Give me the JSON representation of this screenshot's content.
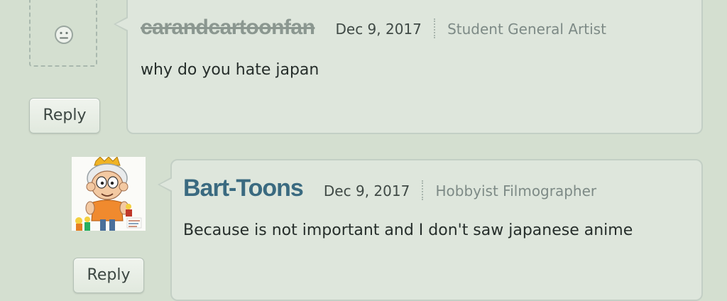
{
  "comments": [
    {
      "username": "carandcartoonfan",
      "username_deleted": true,
      "date": "Dec 9, 2017",
      "user_title": "Student General Artist",
      "text": "why do you hate japan",
      "reply_label": "Reply",
      "avatar_icon": "neutral-face-icon"
    },
    {
      "username": "Bart-Toons",
      "username_deleted": false,
      "date": "Dec 9, 2017",
      "user_title": "Hobbyist Filmographer",
      "text": "Because is not important and I don't saw japanese anime",
      "reply_label": "Reply",
      "avatar_icon": "cartoon-character-avatar"
    }
  ],
  "colors": {
    "background": "#d4dfd0",
    "bubble": "#dee6dc",
    "username_link": "#3a6a80",
    "username_deleted": "#8b9790"
  }
}
